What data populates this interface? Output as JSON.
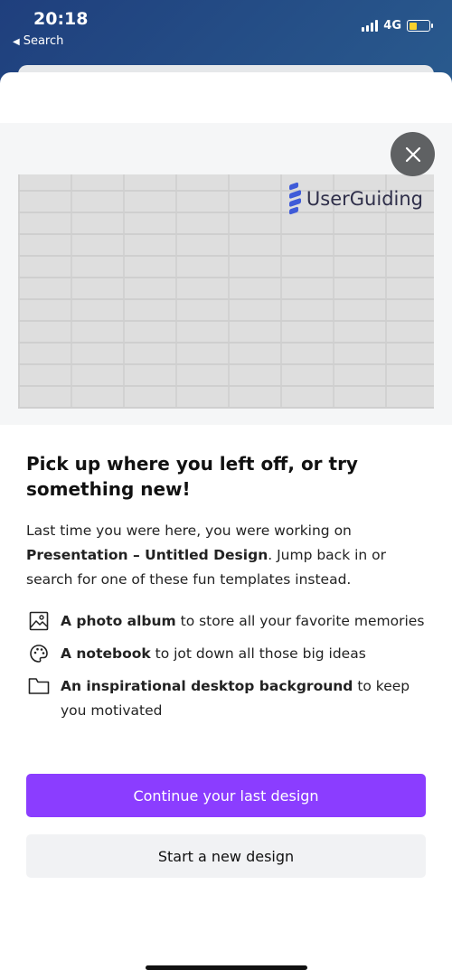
{
  "status_bar": {
    "time": "20:18",
    "back_label": "Search",
    "network": "4G",
    "battery_level": 0.4
  },
  "hero": {
    "brand_name": "UserGuiding",
    "close_icon": "close-icon"
  },
  "content": {
    "headline": "Pick up where you left off, or try something new!",
    "intro_prefix": "Last time you were here, you were working on ",
    "intro_design": "Presentation – Untitled Design",
    "intro_suffix": ". Jump back in or search for one of these fun templates instead.",
    "suggestions": [
      {
        "icon": "image-icon",
        "bold": "A photo album",
        "rest": " to store all your favorite memories"
      },
      {
        "icon": "palette-icon",
        "bold": "A notebook",
        "rest": " to jot down all those big ideas"
      },
      {
        "icon": "folder-icon",
        "bold": "An inspirational desktop background",
        "rest": " to keep you motivated"
      }
    ]
  },
  "actions": {
    "continue_label": "Continue your last design",
    "new_label": "Start a new design"
  },
  "colors": {
    "primary": "#8b3dff",
    "secondary_bg": "#f1f2f4",
    "close_bg": "#5f6163",
    "brand_blue": "#3f5bd8"
  }
}
